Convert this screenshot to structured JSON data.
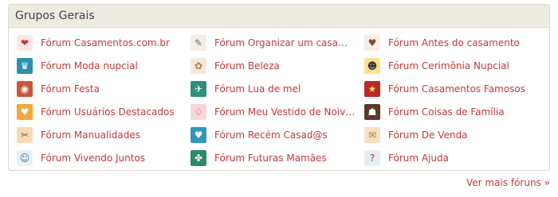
{
  "panel": {
    "title": "Grupos Gerais"
  },
  "forums": [
    {
      "label": "Fórum Casamentos.com.br",
      "icon": "heart-icon",
      "glyph": "❤",
      "bg": "#fbe7e7",
      "fg": "#c0393b"
    },
    {
      "label": "Fórum Organizar um casamento",
      "icon": "planner-icon",
      "glyph": "✎",
      "bg": "#f1efe7",
      "fg": "#7a6a4a"
    },
    {
      "label": "Fórum Antes do casamento",
      "icon": "couple-icon",
      "glyph": "♥",
      "bg": "#f7efe6",
      "fg": "#8a4a3a"
    },
    {
      "label": "Fórum Moda nupcial",
      "icon": "bride-dress-icon",
      "glyph": "♛",
      "bg": "#2f8fb0",
      "fg": "#ffffff"
    },
    {
      "label": "Fórum Beleza",
      "icon": "beauty-icon",
      "glyph": "✿",
      "bg": "#f6e8dc",
      "fg": "#c07040"
    },
    {
      "label": "Fórum Cerimônia Nupcial",
      "icon": "ceremony-icon",
      "glyph": "☻",
      "bg": "#ffe08a",
      "fg": "#333333"
    },
    {
      "label": "Fórum Festa",
      "icon": "party-icon",
      "glyph": "◉",
      "bg": "#c9553a",
      "fg": "#ffffff"
    },
    {
      "label": "Fórum Lua de mel",
      "icon": "suitcase-icon",
      "glyph": "✈",
      "bg": "#2e8f7a",
      "fg": "#ffffff"
    },
    {
      "label": "Fórum Casamentos Famosos",
      "icon": "star-icon",
      "glyph": "★",
      "bg": "#b8292b",
      "fg": "#ffd23a"
    },
    {
      "label": "Fórum Usuários Destacados",
      "icon": "featured-heart-icon",
      "glyph": "♥",
      "bg": "#f4a73a",
      "fg": "#ffffff"
    },
    {
      "label": "Fórum Meu Vestido de Noiva é...",
      "icon": "dress-icon",
      "glyph": "♢",
      "bg": "#f7d6dc",
      "fg": "#c0393b"
    },
    {
      "label": "Fórum Coisas de Família",
      "icon": "family-icon",
      "glyph": "☗",
      "bg": "#5a3a28",
      "fg": "#ffffff"
    },
    {
      "label": "Fórum Manualidades",
      "icon": "crafts-icon",
      "glyph": "✂",
      "bg": "#f6d9b8",
      "fg": "#a05a2a"
    },
    {
      "label": "Fórum Recém Casad@s",
      "icon": "newlyweds-icon",
      "glyph": "♥",
      "bg": "#2f97b8",
      "fg": "#ffffff"
    },
    {
      "label": "Fórum De Venda",
      "icon": "sale-tag-icon",
      "glyph": "✉",
      "bg": "#f6e2c2",
      "fg": "#b07a3a"
    },
    {
      "label": "Fórum Vivendo Juntos",
      "icon": "living-together-icon",
      "glyph": "☺",
      "bg": "#e8f1f6",
      "fg": "#3a7ab0"
    },
    {
      "label": "Fórum Futuras Mamães",
      "icon": "future-mom-icon",
      "glyph": "✤",
      "bg": "#2a8a6a",
      "fg": "#ffffff"
    },
    {
      "label": "Fórum Ajuda",
      "icon": "help-icon",
      "glyph": "?",
      "bg": "#e3eef6",
      "fg": "#c0393b"
    }
  ],
  "footer": {
    "more_label": "Ver mais fóruns »"
  }
}
